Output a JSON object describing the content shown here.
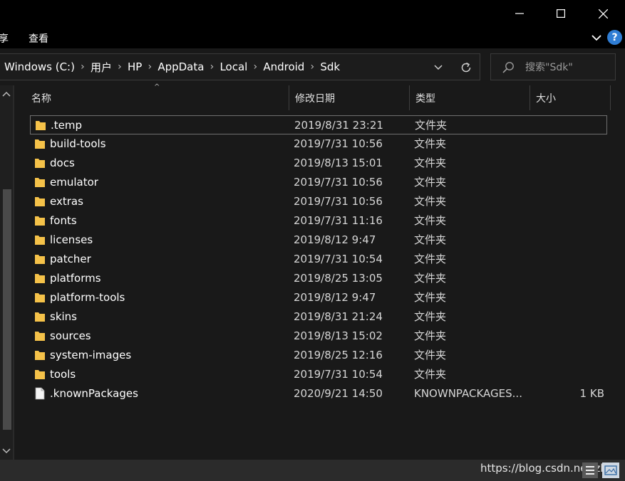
{
  "window": {
    "controls": [
      "minimize-icon",
      "maximize-icon",
      "close-icon"
    ]
  },
  "ribbon": {
    "cut_text": "享",
    "view_tab": "查看",
    "help_label": "?"
  },
  "address": {
    "crumbs": [
      "Windows (C:)",
      "用户",
      "HP",
      "AppData",
      "Local",
      "Android",
      "Sdk"
    ],
    "separator": "›"
  },
  "search": {
    "placeholder": "搜索\"Sdk\""
  },
  "columns": {
    "name": "名称",
    "date": "修改日期",
    "type": "类型",
    "size": "大小",
    "sort_indicator": "^"
  },
  "colors": {
    "folder": "#f5c249",
    "accent": "#2f7dd4",
    "background": "#191919"
  },
  "files": [
    {
      "name": ".temp",
      "date": "2019/8/31 23:21",
      "type": "文件夹",
      "size": "",
      "icon": "folder-icon",
      "selected": true
    },
    {
      "name": "build-tools",
      "date": "2019/7/31 10:56",
      "type": "文件夹",
      "size": "",
      "icon": "folder-icon"
    },
    {
      "name": "docs",
      "date": "2019/8/13 15:01",
      "type": "文件夹",
      "size": "",
      "icon": "folder-icon"
    },
    {
      "name": "emulator",
      "date": "2019/7/31 10:56",
      "type": "文件夹",
      "size": "",
      "icon": "folder-icon"
    },
    {
      "name": "extras",
      "date": "2019/7/31 10:56",
      "type": "文件夹",
      "size": "",
      "icon": "folder-icon"
    },
    {
      "name": "fonts",
      "date": "2019/7/31 11:16",
      "type": "文件夹",
      "size": "",
      "icon": "folder-icon"
    },
    {
      "name": "licenses",
      "date": "2019/8/12 9:47",
      "type": "文件夹",
      "size": "",
      "icon": "folder-icon"
    },
    {
      "name": "patcher",
      "date": "2019/7/31 10:54",
      "type": "文件夹",
      "size": "",
      "icon": "folder-icon"
    },
    {
      "name": "platforms",
      "date": "2019/8/25 13:05",
      "type": "文件夹",
      "size": "",
      "icon": "folder-icon"
    },
    {
      "name": "platform-tools",
      "date": "2019/8/12 9:47",
      "type": "文件夹",
      "size": "",
      "icon": "folder-icon"
    },
    {
      "name": "skins",
      "date": "2019/8/31 21:24",
      "type": "文件夹",
      "size": "",
      "icon": "folder-icon"
    },
    {
      "name": "sources",
      "date": "2019/8/13 15:02",
      "type": "文件夹",
      "size": "",
      "icon": "folder-icon"
    },
    {
      "name": "system-images",
      "date": "2019/8/25 12:16",
      "type": "文件夹",
      "size": "",
      "icon": "folder-icon"
    },
    {
      "name": "tools",
      "date": "2019/7/31 10:54",
      "type": "文件夹",
      "size": "",
      "icon": "folder-icon"
    },
    {
      "name": ".knownPackages",
      "date": "2020/9/21 14:50",
      "type": "KNOWNPACKAGES...",
      "size": "1 KB",
      "icon": "file-icon"
    }
  ],
  "status": {
    "watermark": "https://blog.csdn.net/zbyy"
  }
}
